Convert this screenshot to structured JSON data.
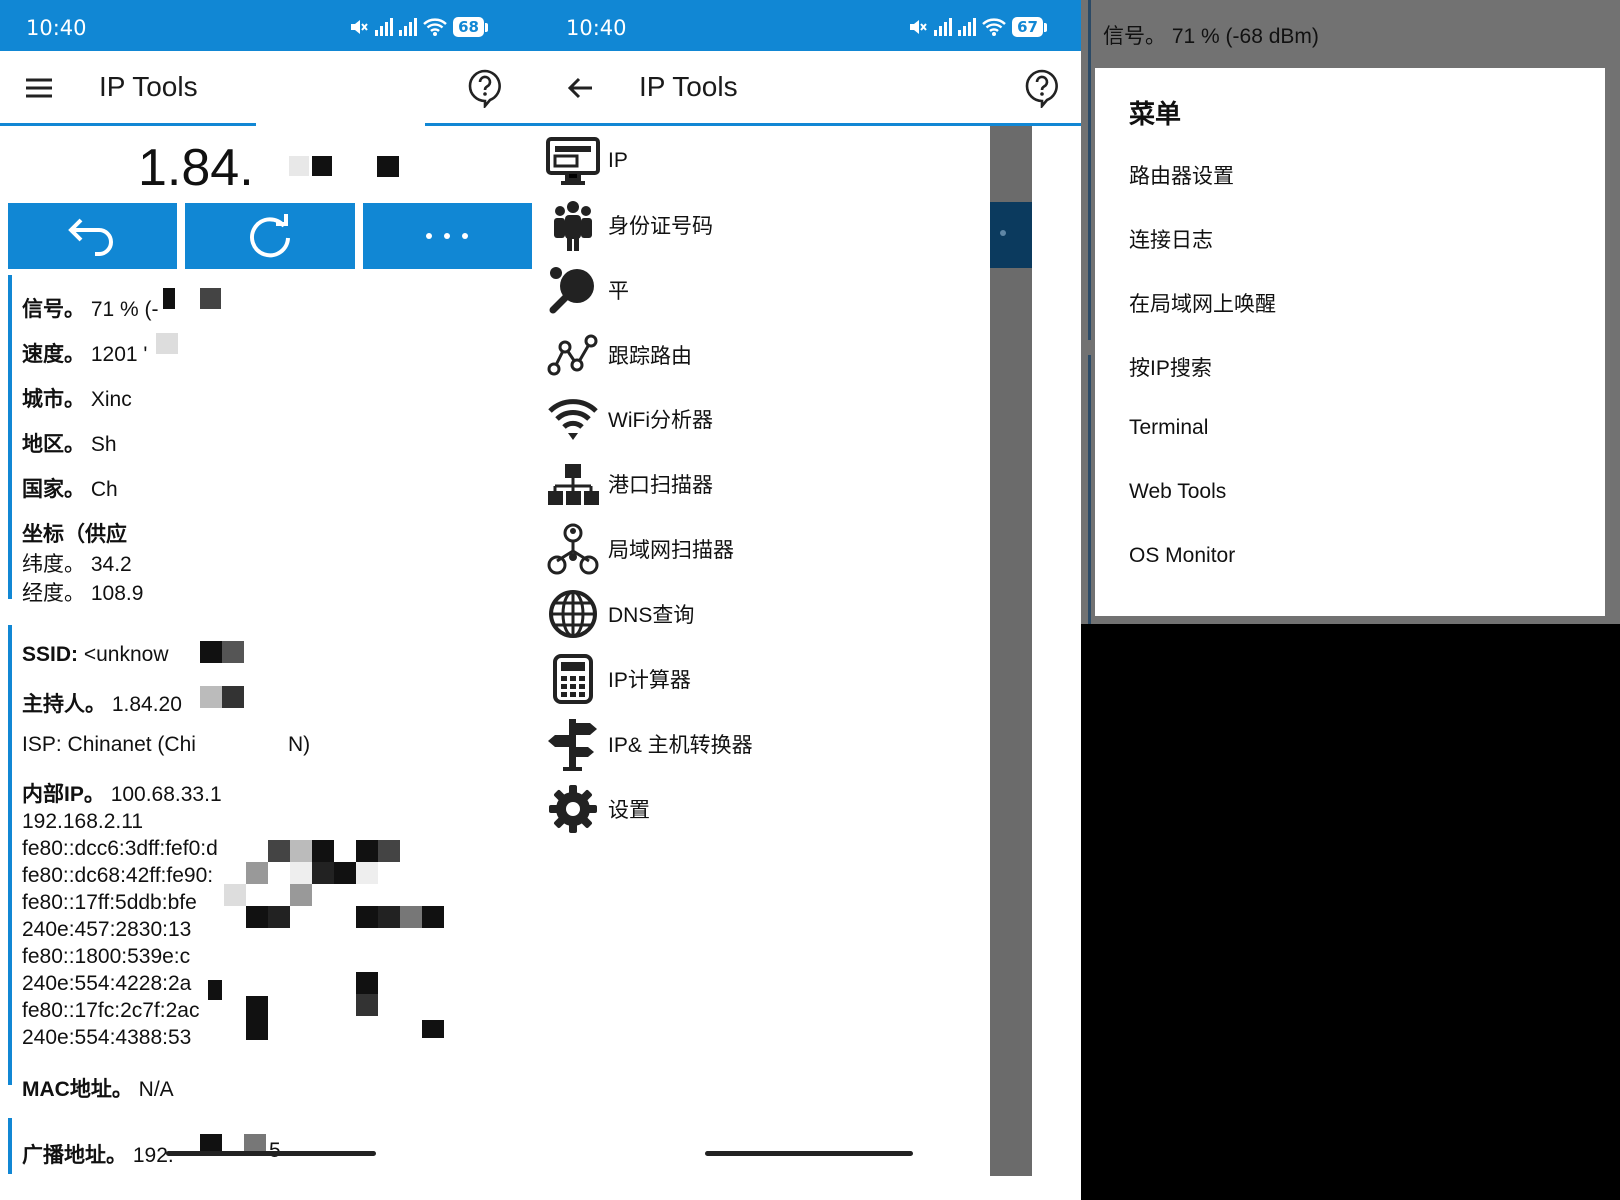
{
  "status": {
    "time": "10:40",
    "battery_left": "68",
    "battery_mid": "67"
  },
  "app": {
    "title": "IP Tools"
  },
  "main": {
    "ip_partial": "1.84.",
    "info": {
      "signal_label": "信号。",
      "signal_value": "71 % (-",
      "speed_label": "速度。",
      "speed_value": "1201 '",
      "city_label": "城市。",
      "city_value": "Xinc",
      "region_label": "地区。",
      "region_value": "Sh",
      "country_label": "国家。",
      "country_value": "Ch",
      "coords_label": "坐标（供应",
      "lat_label": "纬度。",
      "lat_value": "34.2",
      "lon_label": "经度。",
      "lon_value": "108.9",
      "ssid_label": "SSID:",
      "ssid_value": "<unknow",
      "host_label": "主持人。",
      "host_value": "1.84.20",
      "isp_label": "ISP:",
      "isp_value": "Chinanet (Chi",
      "isp_tail": "N)",
      "internal_label": "内部IP。",
      "internal_first": "100.68.33.1",
      "internal_lines": [
        "192.168.2.11",
        "fe80::dcc6:3dff:fef0:d9",
        "fe80::dc68:42ff:fe90:",
        "fe80::17ff:5ddb:bfe",
        "240e:457:2830:13",
        "fe80::1800:539e:c",
        "240e:554:4228:2a",
        "fe80::17fc:2c7f:2ac",
        "240e:554:4388:53"
      ],
      "mac_label": "MAC地址。",
      "mac_value": "N/A",
      "broadcast_label": "广播地址。",
      "broadcast_value": "192.",
      "broadcast_tail": "5"
    }
  },
  "tools_menu": [
    {
      "label": "IP",
      "icon": "monitor-icon"
    },
    {
      "label": "身份证号码",
      "icon": "people-icon"
    },
    {
      "label": "平",
      "icon": "ping-pong-icon"
    },
    {
      "label": "跟踪路由",
      "icon": "trace-route-icon"
    },
    {
      "label": "WiFi分析器",
      "icon": "wifi-icon"
    },
    {
      "label": "港口扫描器",
      "icon": "port-scanner-icon"
    },
    {
      "label": "局域网扫描器",
      "icon": "lan-scanner-icon"
    },
    {
      "label": "DNS查询",
      "icon": "globe-icon"
    },
    {
      "label": "IP计算器",
      "icon": "calculator-icon"
    },
    {
      "label": "IP& 主机转换器",
      "icon": "signpost-icon"
    },
    {
      "label": "设置",
      "icon": "gear-icon"
    }
  ],
  "overlay": {
    "signal_text": "信号。 71 % (-68 dBm)",
    "menu_title": "菜单",
    "menu_items": [
      "路由器设置",
      "连接日志",
      "在局域网上唤醒",
      "按IP搜索",
      "Terminal",
      "Web Tools",
      "OS Monitor"
    ]
  },
  "colors": {
    "accent": "#1187d4",
    "dim": "#727272"
  }
}
